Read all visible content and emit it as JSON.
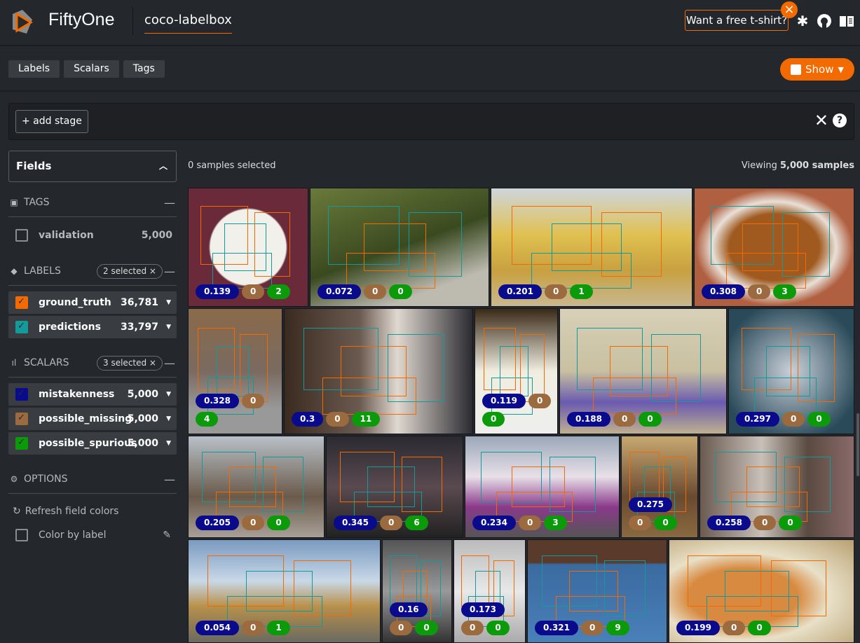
{
  "header": {
    "brand": "FiftyOne",
    "dataset": "coco-labelbox",
    "tshirt": "Want a free t-shirt?",
    "icons": [
      "slack-icon",
      "github-icon",
      "docs-book-icon"
    ]
  },
  "tabs": [
    "Labels",
    "Scalars",
    "Tags"
  ],
  "show_button": "Show",
  "stage_bar": {
    "add_stage": "+ add stage"
  },
  "sidebar": {
    "fields_title": "Fields",
    "tags": {
      "title": "TAGS",
      "items": [
        {
          "label": "validation",
          "count": "5,000"
        }
      ]
    },
    "labels": {
      "title": "LABELS",
      "selected": "2 selected ×",
      "items": [
        {
          "label": "ground_truth",
          "count": "36,781",
          "color": "#f36b00"
        },
        {
          "label": "predictions",
          "count": "33,797",
          "color": "#139a9a"
        }
      ]
    },
    "scalars": {
      "title": "SCALARS",
      "selected": "3 selected ×",
      "items": [
        {
          "label": "mistakenness",
          "count": "5,000",
          "color": "#0a0a8c"
        },
        {
          "label": "possible_missing",
          "count": "5,000",
          "color": "#9b6a3f"
        },
        {
          "label": "possible_spurious",
          "count": "5,000",
          "color": "#0a9a0a"
        }
      ]
    },
    "options": {
      "title": "OPTIONS",
      "refresh": "Refresh field colors",
      "color_by_label": "Color by label"
    }
  },
  "grid_header": {
    "selected": "0 samples selected",
    "viewing_prefix": "Viewing ",
    "viewing_count": "5,000 samples"
  },
  "badge_colors": {
    "mistakenness": "#0a0a8c",
    "possible_missing": "#9b6a3f",
    "possible_spurious": "#0a9a0a"
  },
  "samples": [
    [
      "0.139",
      "0",
      "2"
    ],
    [
      "0.072",
      "0",
      "0"
    ],
    [
      "0.201",
      "0",
      "1"
    ],
    [
      "0.308",
      "0",
      "3"
    ],
    [
      "0.328",
      "0",
      "4"
    ],
    [
      "0.3",
      "0",
      "11"
    ],
    [
      "0.119",
      "0",
      "0"
    ],
    [
      "0.188",
      "0",
      "0"
    ],
    [
      "0.297",
      "0",
      "0"
    ],
    [
      "0.205",
      "0",
      "0"
    ],
    [
      "0.345",
      "0",
      "6"
    ],
    [
      "0.234",
      "0",
      "3"
    ],
    [
      "0.275",
      "0",
      "0"
    ],
    [
      "0.258",
      "0",
      "0"
    ],
    [
      "0.054",
      "0",
      "1"
    ],
    [
      "0.16",
      "0",
      "0"
    ],
    [
      "0.173",
      "0",
      "0"
    ],
    [
      "0.321",
      "0",
      "9"
    ],
    [
      "0.199",
      "0",
      "0"
    ]
  ]
}
